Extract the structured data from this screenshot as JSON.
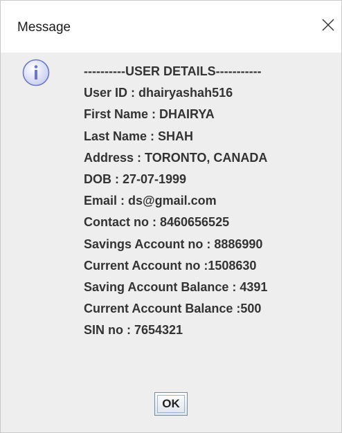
{
  "dialog": {
    "title": "Message",
    "ok_label": "OK"
  },
  "icons": {
    "close": "close-icon",
    "info": "info-icon"
  },
  "colors": {
    "icon_fill": "#d6dcf7",
    "icon_border": "#6e77c4",
    "text": "#333333",
    "background": "#eeeeee"
  },
  "details": [
    "----------USER DETAILS-----------",
    "User ID : dhairyashah516",
    "First Name : DHAIRYA",
    "Last Name : SHAH",
    "Address : TORONTO, CANADA",
    "DOB : 27-07-1999",
    "Email : ds@gmail.com",
    "Contact no : 8460656525",
    "Savings Account no : 8886990",
    "Current Account no :1508630",
    "Saving Account Balance : 4391",
    "Current Account Balance :500",
    "SIN no : 7654321"
  ]
}
